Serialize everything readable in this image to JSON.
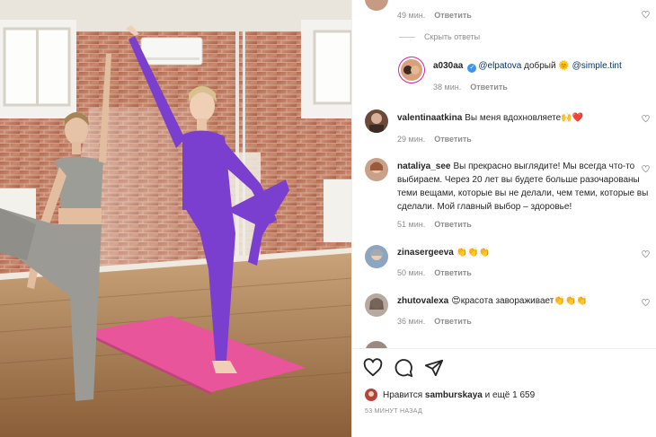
{
  "comments": [
    {
      "id": "c0",
      "meta_time": "49 мин.",
      "reply_label": "Ответить"
    },
    {
      "id": "hide",
      "hide_replies_label": "Скрыть ответы"
    },
    {
      "id": "c1",
      "user": "a030aa",
      "verified": true,
      "text_mention1": "@elpatova",
      "text_mid": " добрый ",
      "emoji": "🌞",
      "text_mention2": " @simple.tint",
      "meta_time": "38 мин.",
      "reply_label": "Ответить"
    },
    {
      "id": "c2",
      "user": "valentinaatkina",
      "text": "Вы меня вдохновляете",
      "emoji": "🙌❤️",
      "meta_time": "29 мин.",
      "reply_label": "Ответить"
    },
    {
      "id": "c3",
      "user": "nataliya_see",
      "text": "Вы прекрасно выглядите! Мы всегда что-то выбираем. Через 20 лет вы будете больше разочарованы теми вещами, которые вы не делали, чем теми, которые вы сделали. Мой главный выбор – здоровье!",
      "meta_time": "51 мин.",
      "reply_label": "Ответить"
    },
    {
      "id": "c4",
      "user": "zinasergeeva",
      "emoji": "👏👏👏",
      "meta_time": "50 мин.",
      "reply_label": "Ответить"
    },
    {
      "id": "c5",
      "user": "zhutovalexa",
      "emoji_pre": "😍",
      "text": "красота завораживает",
      "emoji": "👏👏👏",
      "meta_time": "36 мин.",
      "reply_label": "Ответить"
    }
  ],
  "actions": {
    "like_icon": "heart-outline-icon",
    "comment_icon": "comment-bubble-icon",
    "share_icon": "paper-plane-icon"
  },
  "likes": {
    "prefix": "Нравится",
    "user": "samburskaya",
    "suffix": "и ещё 1 659"
  },
  "time_ago": "53 МИНУТ НАЗАД",
  "colors": {
    "mention": "#00376b",
    "verified": "#3897f0",
    "meta": "#8e8e8e",
    "mat": "#e8559a",
    "outfit": "#7b3fd0"
  }
}
